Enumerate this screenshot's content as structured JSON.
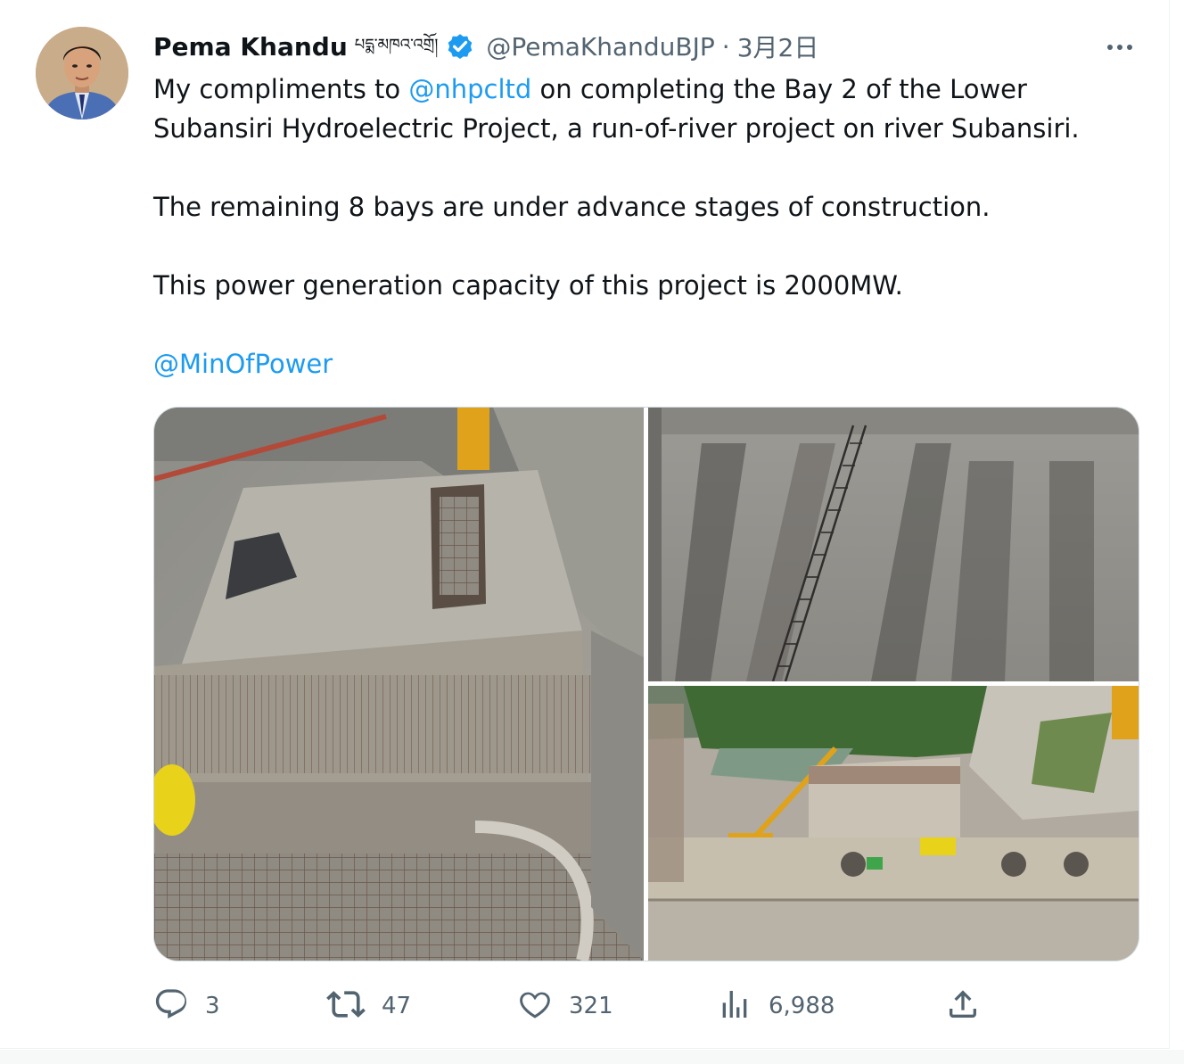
{
  "tweet": {
    "author_name": "Pema Khandu",
    "author_name_tibetan": "པདྨ་མཁའ་འགྲོ།",
    "handle": "@PemaKhanduBJP",
    "separator": "·",
    "date": "3月2日",
    "text": {
      "line1_pre": "My compliments to ",
      "mention1": "@nhpcltd",
      "line1_post": " on completing the Bay 2 of the Lower Subansiri Hydroelectric Project, a run-of-river project on river Subansiri.",
      "para2": "The remaining 8 bays are under advance stages of construction.",
      "para3": "This power generation capacity of this project is 2000MW.",
      "mention2": "@MinOfPower"
    },
    "media": [
      {
        "name": "dam-bay-construction-photo"
      },
      {
        "name": "dam-concrete-wall-photo"
      },
      {
        "name": "dam-site-overview-photo"
      }
    ],
    "actions": {
      "reply_count": "3",
      "retweet_count": "47",
      "like_count": "321",
      "views_count": "6,988"
    }
  },
  "icons": {
    "verified": "verified-badge-icon",
    "more": "more-options-icon",
    "reply": "reply-icon",
    "retweet": "retweet-icon",
    "like": "heart-icon",
    "views": "views-chart-icon",
    "share": "share-icon"
  },
  "colors": {
    "link": "#1d9bf0",
    "secondary_text": "#536471",
    "primary_text": "#0f1419"
  }
}
